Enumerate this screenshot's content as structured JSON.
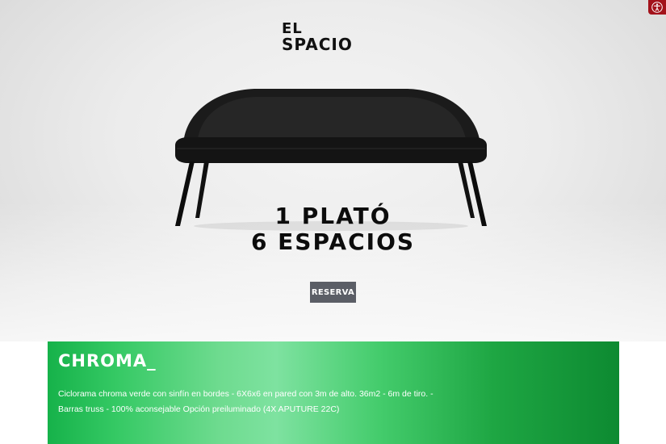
{
  "header": {
    "logo_line1": "EL",
    "logo_line2": "SPACIO"
  },
  "hero": {
    "headline_line1": "1 PLATÓ",
    "headline_line2": "6 ESPACIOS",
    "reserve_label": "RESERVA"
  },
  "accessibility": {
    "icon": "accessibility-icon"
  },
  "chroma": {
    "title": "CHROMA_",
    "description_line1": "Ciclorama chroma verde con sinfín en bordes - 6X6x6 en pared con 3m de alto. 36m2 - 6m de tiro. -",
    "description_line2": "Barras truss - 100% aconsejable Opción preiluminado (4X APUTURE 22C)"
  },
  "colors": {
    "button_bg": "#5b5e66",
    "accessibility_bg": "#a3121b",
    "chroma_green": "#1ea643"
  }
}
